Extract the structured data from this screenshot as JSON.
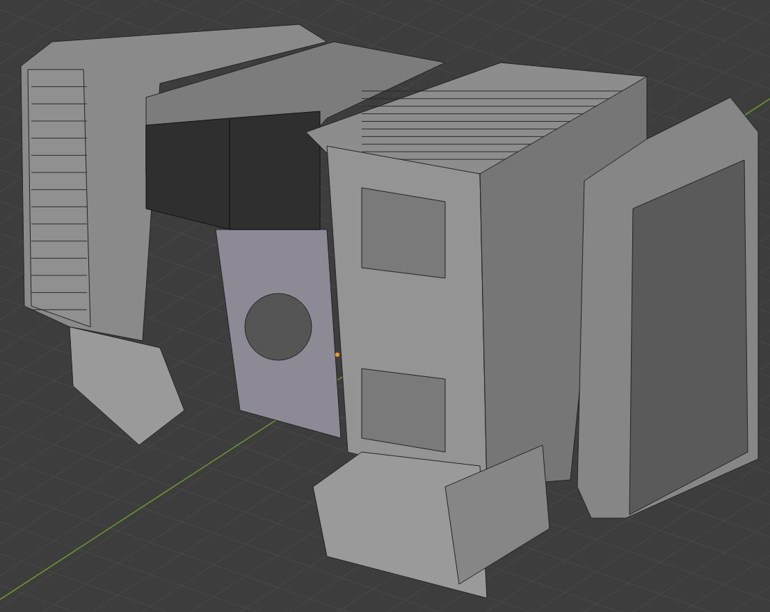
{
  "viewport": {
    "grid_visible": true,
    "origin_marker": true
  }
}
